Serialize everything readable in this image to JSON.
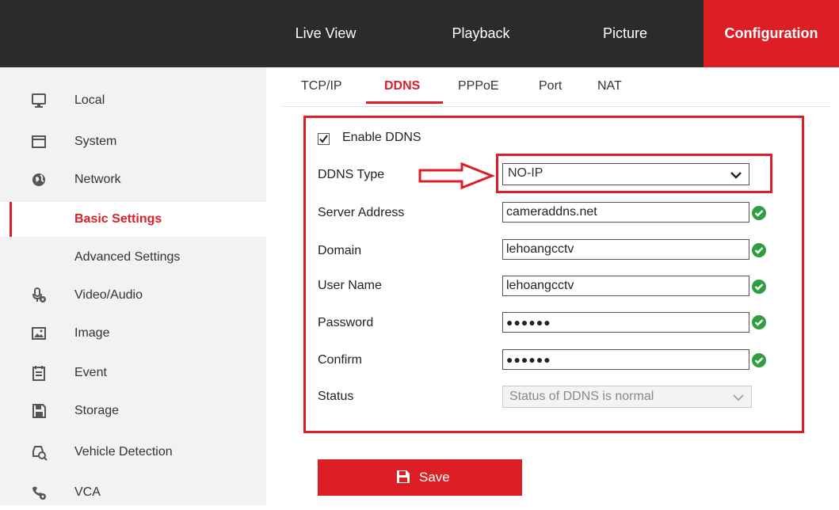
{
  "nav": {
    "items": [
      "Live View",
      "Playback",
      "Picture",
      "Configuration"
    ],
    "active": "Configuration"
  },
  "sidebar": {
    "items": [
      {
        "label": "Local",
        "icon": "monitor-icon"
      },
      {
        "label": "System",
        "icon": "window-icon"
      },
      {
        "label": "Network",
        "icon": "globe-icon"
      },
      {
        "label": "Basic Settings",
        "icon": ""
      },
      {
        "label": "Advanced Settings",
        "icon": ""
      },
      {
        "label": "Video/Audio",
        "icon": "microphone-gear-icon"
      },
      {
        "label": "Image",
        "icon": "image-icon"
      },
      {
        "label": "Event",
        "icon": "calendar-icon"
      },
      {
        "label": "Storage",
        "icon": "floppy-icon"
      },
      {
        "label": "Vehicle Detection",
        "icon": "vehicle-search-icon"
      },
      {
        "label": "VCA",
        "icon": "vca-icon"
      }
    ],
    "active": "Basic Settings"
  },
  "tabs": {
    "items": [
      "TCP/IP",
      "DDNS",
      "PPPoE",
      "Port",
      "NAT"
    ],
    "active": "DDNS"
  },
  "form": {
    "enable_ddns": {
      "label": "Enable DDNS",
      "checked": true
    },
    "ddns_type": {
      "label": "DDNS Type",
      "value": "NO-IP"
    },
    "server_address": {
      "label": "Server Address",
      "value": "cameraddns.net"
    },
    "domain": {
      "label": "Domain",
      "value": "lehoangcctv"
    },
    "user_name": {
      "label": "User Name",
      "value": "lehoangcctv"
    },
    "password": {
      "label": "Password",
      "value": "●●●●●●"
    },
    "confirm": {
      "label": "Confirm",
      "value": "●●●●●●"
    },
    "status": {
      "label": "Status",
      "value": "Status of DDNS is normal"
    }
  },
  "save_label": "Save",
  "colors": {
    "accent": "#dd1e25",
    "topbar": "#2b2b2b",
    "sidebar": "#f2f2f2",
    "valid": "#2e9e3f"
  }
}
